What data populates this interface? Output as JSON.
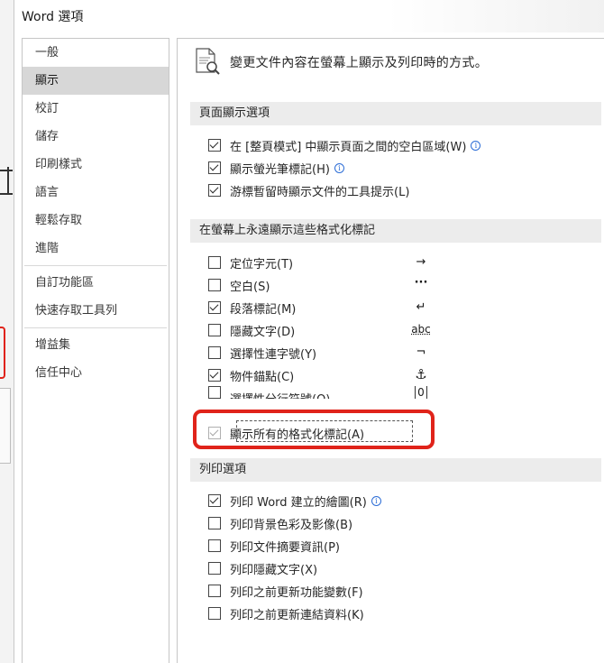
{
  "window": {
    "title": "Word 選項"
  },
  "nav": {
    "items": [
      {
        "label": "一般",
        "selected": false
      },
      {
        "label": "顯示",
        "selected": true
      },
      {
        "label": "校訂",
        "selected": false
      },
      {
        "label": "儲存",
        "selected": false
      },
      {
        "label": "印刷樣式",
        "selected": false
      },
      {
        "label": "語言",
        "selected": false
      },
      {
        "label": "輕鬆存取",
        "selected": false
      },
      {
        "label": "進階",
        "selected": false
      },
      {
        "label": "自訂功能區",
        "selected": false
      },
      {
        "label": "快速存取工具列",
        "selected": false
      },
      {
        "label": "增益集",
        "selected": false
      },
      {
        "label": "信任中心",
        "selected": false
      }
    ]
  },
  "content": {
    "heading": "變更文件內容在螢幕上顯示及列印時的方式。",
    "sections": {
      "page_display": "頁面顯示選項",
      "formatting_marks": "在螢幕上永遠顯示這些格式化標記",
      "print": "列印選項"
    },
    "page_display_options": [
      {
        "label": "在 [整頁模式] 中顯示頁面之間的空白區域(W)",
        "checked": true,
        "info": true
      },
      {
        "label": "顯示螢光筆標記(H)",
        "checked": true,
        "info": true
      },
      {
        "label": "游標暫留時顯示文件的工具提示(L)",
        "checked": true,
        "info": false
      }
    ],
    "formatting_marks_options": [
      {
        "label": "定位字元(T)",
        "checked": false,
        "symbol": "→"
      },
      {
        "label": "空白(S)",
        "checked": false,
        "symbol": "···"
      },
      {
        "label": "段落標記(M)",
        "checked": true,
        "symbol": "↵"
      },
      {
        "label": "隱藏文字(D)",
        "checked": false,
        "symbol": "abc"
      },
      {
        "label": "選擇性連字號(Y)",
        "checked": false,
        "symbol": "¬"
      },
      {
        "label": "物件錨點(C)",
        "checked": true,
        "symbol": "⚓"
      },
      {
        "label": "選擇性分行符號(O)",
        "checked": false,
        "symbol": "0"
      },
      {
        "label": "顯示所有的格式化標記(A)",
        "checked": true,
        "disabled": true
      }
    ],
    "print_options": [
      {
        "label": "列印 Word 建立的繪圖(R)",
        "checked": true,
        "info": true
      },
      {
        "label": "列印背景色彩及影像(B)",
        "checked": false,
        "info": false
      },
      {
        "label": "列印文件摘要資訊(P)",
        "checked": false,
        "info": false
      },
      {
        "label": "列印隱藏文字(X)",
        "checked": false,
        "info": false
      },
      {
        "label": "列印之前更新功能變數(F)",
        "checked": false,
        "info": false
      },
      {
        "label": "列印之前更新連結資料(K)",
        "checked": false,
        "info": false
      }
    ],
    "info_glyph": "i"
  },
  "colors": {
    "highlight": "#e0231a",
    "selected_nav": "#d7d7d7",
    "section_bg": "#ececec"
  }
}
